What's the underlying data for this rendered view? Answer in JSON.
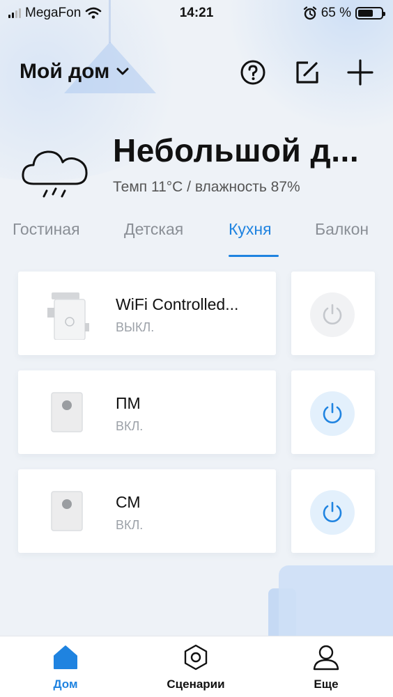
{
  "status_bar": {
    "carrier": "MegaFon",
    "time": "14:21",
    "battery_percent": "65 %",
    "battery_level": 0.65,
    "icons": [
      "signal-icon",
      "wifi-icon",
      "alarm-icon",
      "battery-icon"
    ]
  },
  "header": {
    "home_name": "Мой дом",
    "icons": [
      "chevron-down-icon",
      "help-icon",
      "edit-icon",
      "add-icon"
    ]
  },
  "weather": {
    "title": "Небольшой д...",
    "details": "Темп 11°C / влажность 87%",
    "icon": "rain-cloud-icon"
  },
  "tabs": [
    {
      "label": "Гостиная",
      "active": false
    },
    {
      "label": "Детская",
      "active": false
    },
    {
      "label": "Кухня",
      "active": true
    },
    {
      "label": "Балкон",
      "active": false
    }
  ],
  "devices": [
    {
      "name": "WiFi Controlled...",
      "status": "ВЫКЛ.",
      "power_on": false,
      "icon": "smart-plug-icon"
    },
    {
      "name": "ПМ",
      "status": "ВКЛ.",
      "power_on": true,
      "icon": "switch-module-icon"
    },
    {
      "name": "СМ",
      "status": "ВКЛ.",
      "power_on": true,
      "icon": "switch-module-icon"
    }
  ],
  "bottom_nav": [
    {
      "label": "Дом",
      "icon": "home-icon",
      "active": true
    },
    {
      "label": "Сценарии",
      "icon": "hexagon-icon",
      "active": false
    },
    {
      "label": "Еще",
      "icon": "profile-icon",
      "active": false
    }
  ],
  "colors": {
    "accent": "#1f83e0",
    "background": "#eef2f7",
    "card": "#ffffff",
    "power_on_bg": "#e3f0fc",
    "power_off_bg": "#f1f2f4",
    "power_off_icon": "#c4c7cc"
  }
}
